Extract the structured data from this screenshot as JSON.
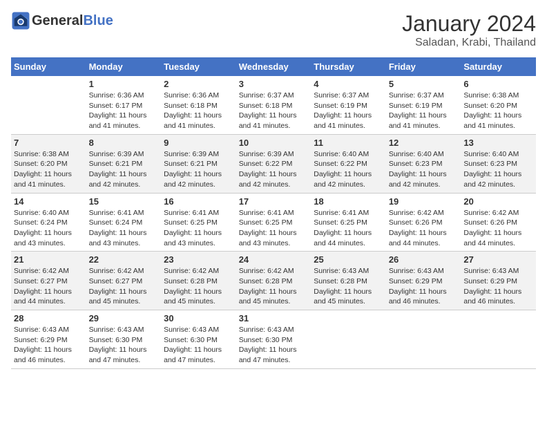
{
  "header": {
    "logo_general": "General",
    "logo_blue": "Blue",
    "month": "January 2024",
    "location": "Saladan, Krabi, Thailand"
  },
  "weekdays": [
    "Sunday",
    "Monday",
    "Tuesday",
    "Wednesday",
    "Thursday",
    "Friday",
    "Saturday"
  ],
  "weeks": [
    [
      {
        "day": "",
        "info": ""
      },
      {
        "day": "1",
        "info": "Sunrise: 6:36 AM\nSunset: 6:17 PM\nDaylight: 11 hours\nand 41 minutes."
      },
      {
        "day": "2",
        "info": "Sunrise: 6:36 AM\nSunset: 6:18 PM\nDaylight: 11 hours\nand 41 minutes."
      },
      {
        "day": "3",
        "info": "Sunrise: 6:37 AM\nSunset: 6:18 PM\nDaylight: 11 hours\nand 41 minutes."
      },
      {
        "day": "4",
        "info": "Sunrise: 6:37 AM\nSunset: 6:19 PM\nDaylight: 11 hours\nand 41 minutes."
      },
      {
        "day": "5",
        "info": "Sunrise: 6:37 AM\nSunset: 6:19 PM\nDaylight: 11 hours\nand 41 minutes."
      },
      {
        "day": "6",
        "info": "Sunrise: 6:38 AM\nSunset: 6:20 PM\nDaylight: 11 hours\nand 41 minutes."
      }
    ],
    [
      {
        "day": "7",
        "info": "Sunrise: 6:38 AM\nSunset: 6:20 PM\nDaylight: 11 hours\nand 41 minutes."
      },
      {
        "day": "8",
        "info": "Sunrise: 6:39 AM\nSunset: 6:21 PM\nDaylight: 11 hours\nand 42 minutes."
      },
      {
        "day": "9",
        "info": "Sunrise: 6:39 AM\nSunset: 6:21 PM\nDaylight: 11 hours\nand 42 minutes."
      },
      {
        "day": "10",
        "info": "Sunrise: 6:39 AM\nSunset: 6:22 PM\nDaylight: 11 hours\nand 42 minutes."
      },
      {
        "day": "11",
        "info": "Sunrise: 6:40 AM\nSunset: 6:22 PM\nDaylight: 11 hours\nand 42 minutes."
      },
      {
        "day": "12",
        "info": "Sunrise: 6:40 AM\nSunset: 6:23 PM\nDaylight: 11 hours\nand 42 minutes."
      },
      {
        "day": "13",
        "info": "Sunrise: 6:40 AM\nSunset: 6:23 PM\nDaylight: 11 hours\nand 42 minutes."
      }
    ],
    [
      {
        "day": "14",
        "info": "Sunrise: 6:40 AM\nSunset: 6:24 PM\nDaylight: 11 hours\nand 43 minutes."
      },
      {
        "day": "15",
        "info": "Sunrise: 6:41 AM\nSunset: 6:24 PM\nDaylight: 11 hours\nand 43 minutes."
      },
      {
        "day": "16",
        "info": "Sunrise: 6:41 AM\nSunset: 6:25 PM\nDaylight: 11 hours\nand 43 minutes."
      },
      {
        "day": "17",
        "info": "Sunrise: 6:41 AM\nSunset: 6:25 PM\nDaylight: 11 hours\nand 43 minutes."
      },
      {
        "day": "18",
        "info": "Sunrise: 6:41 AM\nSunset: 6:25 PM\nDaylight: 11 hours\nand 44 minutes."
      },
      {
        "day": "19",
        "info": "Sunrise: 6:42 AM\nSunset: 6:26 PM\nDaylight: 11 hours\nand 44 minutes."
      },
      {
        "day": "20",
        "info": "Sunrise: 6:42 AM\nSunset: 6:26 PM\nDaylight: 11 hours\nand 44 minutes."
      }
    ],
    [
      {
        "day": "21",
        "info": "Sunrise: 6:42 AM\nSunset: 6:27 PM\nDaylight: 11 hours\nand 44 minutes."
      },
      {
        "day": "22",
        "info": "Sunrise: 6:42 AM\nSunset: 6:27 PM\nDaylight: 11 hours\nand 45 minutes."
      },
      {
        "day": "23",
        "info": "Sunrise: 6:42 AM\nSunset: 6:28 PM\nDaylight: 11 hours\nand 45 minutes."
      },
      {
        "day": "24",
        "info": "Sunrise: 6:42 AM\nSunset: 6:28 PM\nDaylight: 11 hours\nand 45 minutes."
      },
      {
        "day": "25",
        "info": "Sunrise: 6:43 AM\nSunset: 6:28 PM\nDaylight: 11 hours\nand 45 minutes."
      },
      {
        "day": "26",
        "info": "Sunrise: 6:43 AM\nSunset: 6:29 PM\nDaylight: 11 hours\nand 46 minutes."
      },
      {
        "day": "27",
        "info": "Sunrise: 6:43 AM\nSunset: 6:29 PM\nDaylight: 11 hours\nand 46 minutes."
      }
    ],
    [
      {
        "day": "28",
        "info": "Sunrise: 6:43 AM\nSunset: 6:29 PM\nDaylight: 11 hours\nand 46 minutes."
      },
      {
        "day": "29",
        "info": "Sunrise: 6:43 AM\nSunset: 6:30 PM\nDaylight: 11 hours\nand 47 minutes."
      },
      {
        "day": "30",
        "info": "Sunrise: 6:43 AM\nSunset: 6:30 PM\nDaylight: 11 hours\nand 47 minutes."
      },
      {
        "day": "31",
        "info": "Sunrise: 6:43 AM\nSunset: 6:30 PM\nDaylight: 11 hours\nand 47 minutes."
      },
      {
        "day": "",
        "info": ""
      },
      {
        "day": "",
        "info": ""
      },
      {
        "day": "",
        "info": ""
      }
    ]
  ]
}
